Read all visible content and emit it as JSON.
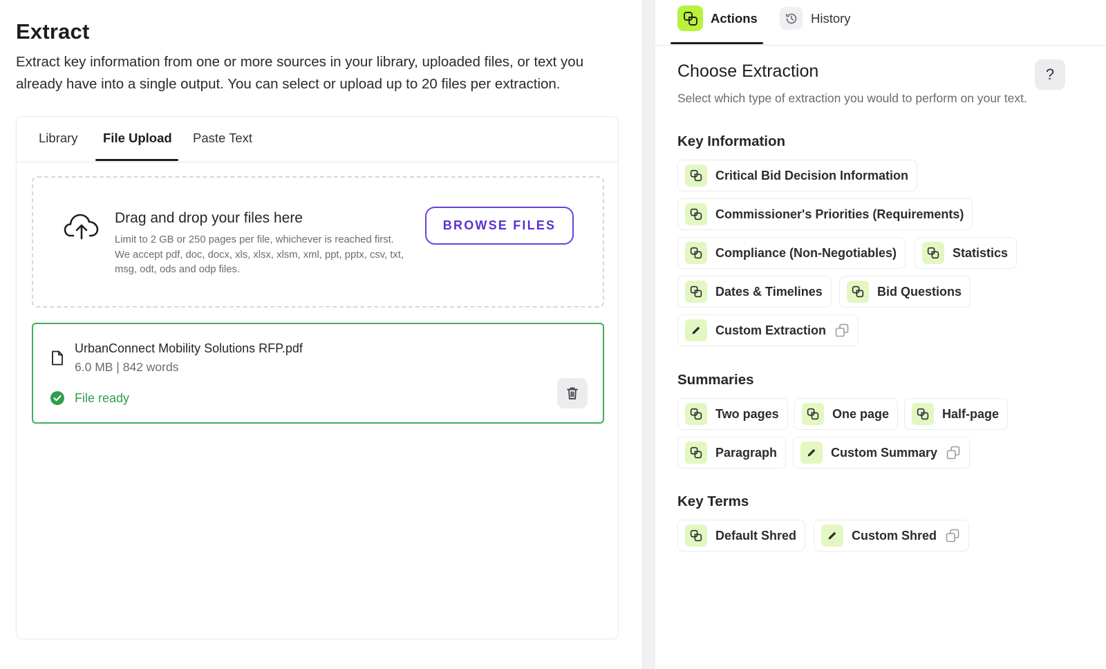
{
  "left": {
    "title": "Extract",
    "description": "Extract key information from one or more sources in your library, uploaded files, or text you already have into a single output. You can select or upload up to 20 files per extraction.",
    "tabs": [
      {
        "label": "Library"
      },
      {
        "label": "File Upload",
        "active": true
      },
      {
        "label": "Paste Text"
      }
    ],
    "dropzone": {
      "title": "Drag and drop your files here",
      "hint": "Limit to 2 GB or 250 pages per file, whichever is reached first. We accept pdf, doc, docx, xls, xlsx, xlsm, xml, ppt, pptx, csv, txt, msg, odt, ods and odp files.",
      "browse_label": "BROWSE FILES"
    },
    "file": {
      "name": "UrbanConnect Mobility Solutions RFP.pdf",
      "meta": "6.0 MB | 842 words",
      "status": "File ready"
    }
  },
  "right": {
    "tabs": [
      {
        "label": "Actions",
        "icon": "extract-icon",
        "active": true
      },
      {
        "label": "History",
        "icon": "history-icon"
      }
    ],
    "title": "Choose Extraction",
    "help_label": "?",
    "description": "Select which type of extraction you would to perform on your text.",
    "sections": {
      "key_information": {
        "title": "Key Information",
        "chips": [
          {
            "label": "Critical Bid Decision Information",
            "icon": "extract-icon"
          },
          {
            "label": "Commissioner's Priorities (Requirements)",
            "icon": "extract-icon"
          },
          {
            "label": "Compliance (Non-Negotiables)",
            "icon": "extract-icon"
          },
          {
            "label": "Statistics",
            "icon": "extract-icon"
          },
          {
            "label": "Dates & Timelines",
            "icon": "extract-icon"
          },
          {
            "label": "Bid Questions",
            "icon": "extract-icon"
          },
          {
            "label": "Custom Extraction",
            "icon": "pencil-icon"
          }
        ]
      },
      "summaries": {
        "title": "Summaries",
        "chips": [
          {
            "label": "Two pages",
            "icon": "extract-icon"
          },
          {
            "label": "One page",
            "icon": "extract-icon"
          },
          {
            "label": "Half-page",
            "icon": "extract-icon"
          },
          {
            "label": "Paragraph",
            "icon": "extract-icon"
          },
          {
            "label": "Custom Summary",
            "icon": "pencil-icon"
          }
        ]
      },
      "key_terms": {
        "title": "Key Terms",
        "chips": [
          {
            "label": "Default Shred",
            "icon": "extract-icon"
          },
          {
            "label": "Custom Shred",
            "icon": "pencil-icon"
          }
        ]
      }
    }
  },
  "colors": {
    "accent_purple": "#5a2fd6",
    "success_green": "#3fae5a",
    "lime_active": "#b8f23b",
    "lime_light": "#e3f7c2"
  }
}
